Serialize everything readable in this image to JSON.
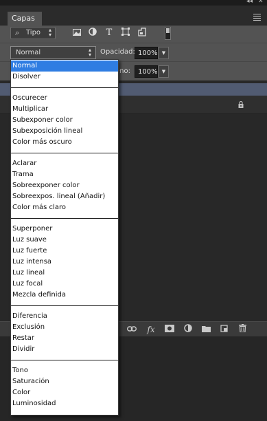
{
  "window": {
    "collapse_glyph": "◂◂",
    "close_glyph": "✕"
  },
  "panel": {
    "tab_label": "Capas",
    "menu_icon": "panel-menu-icon"
  },
  "filter": {
    "kind_label": "Tipo",
    "icons": [
      "image-filter-icon",
      "adjustment-filter-icon",
      "type-filter-icon",
      "shape-filter-icon",
      "smart-object-filter-icon"
    ]
  },
  "blend": {
    "selected": "Normal",
    "opacity_label": "Opacidad:",
    "opacity_value": "100%",
    "fill_label_partial": "eno:",
    "fill_value": "100%"
  },
  "bottom_icons": [
    "link-icon",
    "fx-icon",
    "mask-icon",
    "adjustment-layer-icon",
    "folder-icon",
    "new-layer-icon",
    "trash-icon"
  ],
  "bottom_labels": {
    "fx": "fx"
  },
  "menu": {
    "groups": [
      [
        "Normal",
        "Disolver"
      ],
      [
        "Oscurecer",
        "Multiplicar",
        "Subexponer color",
        "Subexposición lineal",
        "Color más oscuro"
      ],
      [
        "Aclarar",
        "Trama",
        "Sobreexponer color",
        "Sobreexpos. lineal (Añadir)",
        "Color más claro"
      ],
      [
        "Superponer",
        "Luz suave",
        "Luz fuerte",
        "Luz intensa",
        "Luz lineal",
        "Luz focal",
        "Mezcla definida"
      ],
      [
        "Diferencia",
        "Exclusión",
        "Restar",
        "Dividir"
      ],
      [
        "Tono",
        "Saturación",
        "Color",
        "Luminosidad"
      ]
    ],
    "selected_index": 0,
    "highlight_color": "#2f7de2"
  }
}
